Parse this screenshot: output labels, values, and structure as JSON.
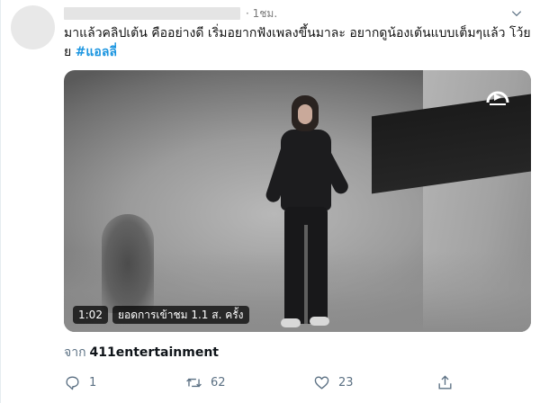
{
  "tweet": {
    "timestamp": "· 1ชม.",
    "text_main": "มาแล้วคลิปเต้น คืออย่างดี เริ่มอยากฟังเพลงขึ้นมาละ อยากดูน้องเต้นแบบเต็มๆแล้ว โว้ยย",
    "hashtag": "#แอลลี่",
    "icons": {
      "menu": "chevron-down-icon",
      "brand": "brand-logo-icon"
    }
  },
  "media": {
    "duration": "1:02",
    "views": "ยอดการเข้าชม 1.1 ส. ครั้ง"
  },
  "source": {
    "prefix": "จาก",
    "name": "411entertainment"
  },
  "actions": {
    "reply_count": "1",
    "retweet_count": "62",
    "like_count": "23"
  },
  "colors": {
    "hashtag": "#1b95e0",
    "muted": "#5b7083",
    "text": "#0f1419"
  }
}
